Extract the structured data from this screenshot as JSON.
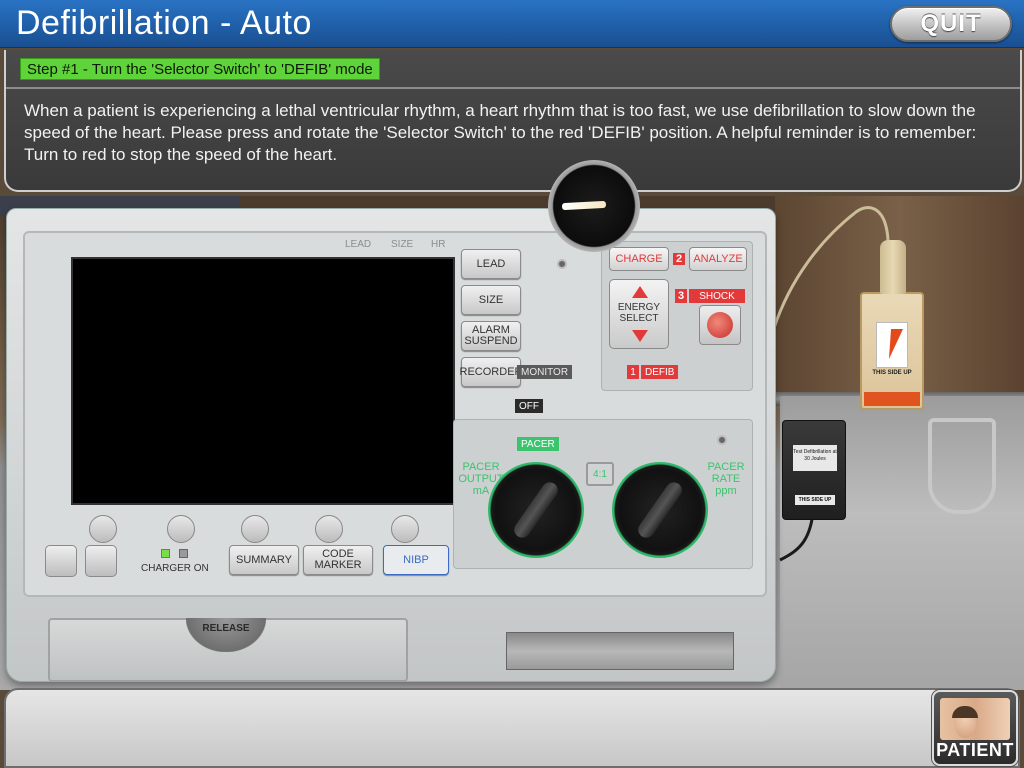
{
  "header": {
    "title": "Defibrillation - Auto",
    "quit_label": "QUIT"
  },
  "instruction": {
    "step_label": "Step #1 - Turn the 'Selector Switch' to 'DEFIB' mode",
    "text": "When a patient is experiencing a lethal ventricular rhythm, a heart rhythm that is too fast, we use defibrillation to slow down the speed of the heart. Please press and rotate the 'Selector Switch' to the red 'DEFIB' position. A helpful reminder is to remember: Turn to red to stop the speed of the heart."
  },
  "device": {
    "screen_labels": {
      "lead": "LEAD",
      "size": "SIZE",
      "hr": "HR"
    },
    "side_buttons": {
      "lead": "LEAD",
      "size": "SIZE",
      "alarm_suspend": "ALARM SUSPEND",
      "recorder": "RECORDER"
    },
    "bottom_buttons": {
      "charger_on": "CHARGER ON",
      "summary": "SUMMARY",
      "code_marker": "CODE MARKER",
      "nibp": "NIBP"
    },
    "controls": {
      "charge": "CHARGE",
      "analyze": "ANALYZE",
      "analyze_num": "2",
      "shock": "SHOCK",
      "shock_num": "3",
      "energy_select": "ENERGY SELECT",
      "monitor": "MONITOR",
      "defib": "DEFIB",
      "defib_num": "1",
      "off": "OFF",
      "pacer": "PACER",
      "pacer_output": "PACER OUTPUT mA",
      "pacer_rate": "PACER RATE ppm",
      "ratio": "4:1"
    },
    "release": "RELEASE",
    "selector_position": "OFF"
  },
  "accessories": {
    "pads_label": "THIS SIDE UP",
    "tester_label": "Test Defibrillation at 30 Joules",
    "tester_side": "THIS SIDE UP"
  },
  "footer": {
    "patient_label": "PATIENT"
  },
  "colors": {
    "header_blue": "#1f5fa8",
    "step_green": "#5fd33a",
    "defib_red": "#e23a3a",
    "pacer_green": "#3cc36e"
  }
}
